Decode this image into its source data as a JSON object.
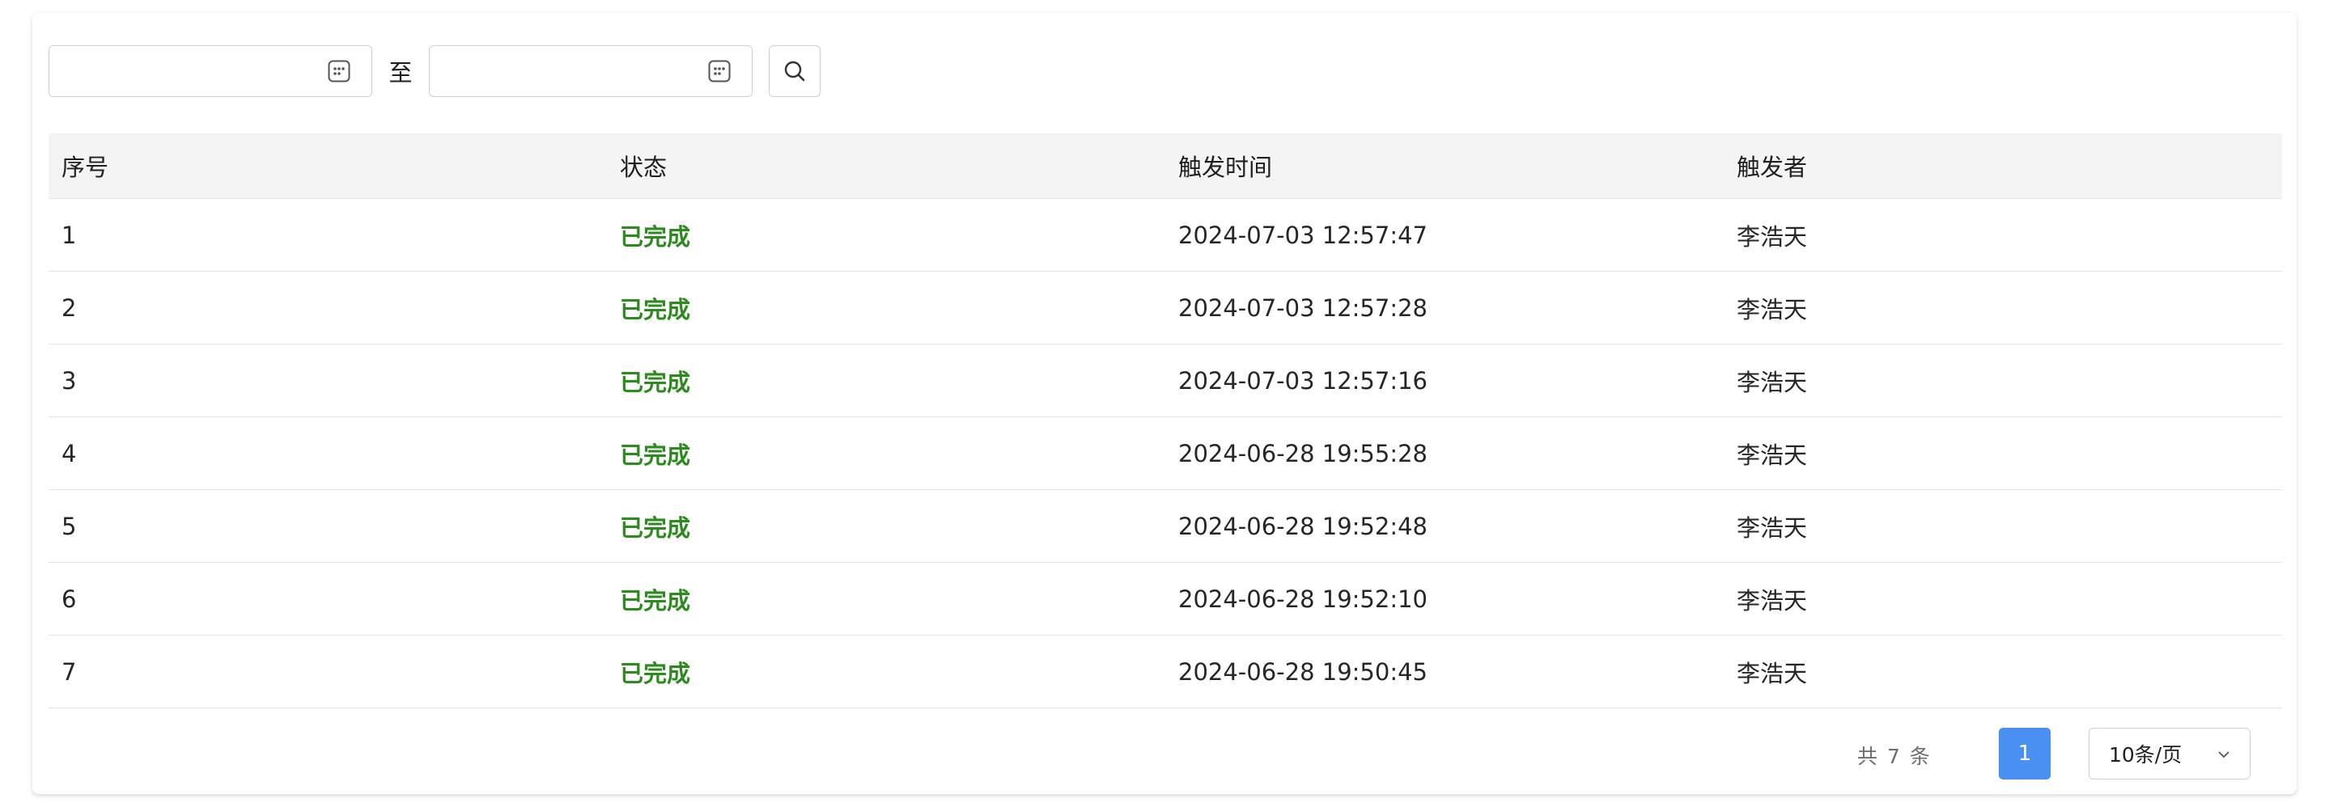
{
  "filter": {
    "start_value": "",
    "end_value": "",
    "separator": "至"
  },
  "table": {
    "columns": [
      "序号",
      "状态",
      "触发时间",
      "触发者"
    ],
    "rows": [
      {
        "index": "1",
        "status": "已完成",
        "time": "2024-07-03 12:57:47",
        "user": "李浩天"
      },
      {
        "index": "2",
        "status": "已完成",
        "time": "2024-07-03 12:57:28",
        "user": "李浩天"
      },
      {
        "index": "3",
        "status": "已完成",
        "time": "2024-07-03 12:57:16",
        "user": "李浩天"
      },
      {
        "index": "4",
        "status": "已完成",
        "time": "2024-06-28 19:55:28",
        "user": "李浩天"
      },
      {
        "index": "5",
        "status": "已完成",
        "time": "2024-06-28 19:52:48",
        "user": "李浩天"
      },
      {
        "index": "6",
        "status": "已完成",
        "time": "2024-06-28 19:52:10",
        "user": "李浩天"
      },
      {
        "index": "7",
        "status": "已完成",
        "time": "2024-06-28 19:50:45",
        "user": "李浩天"
      }
    ]
  },
  "pagination": {
    "total_text": "共 7 条",
    "current_page": "1",
    "page_size": "10条/页"
  },
  "colors": {
    "status_done": "#2d8a1f",
    "accent": "#4a90f0",
    "header_bg": "#f4f4f4"
  },
  "icons": {
    "calendar": "calendar-icon",
    "search": "search-icon",
    "chevron": "chevron-down-icon"
  }
}
